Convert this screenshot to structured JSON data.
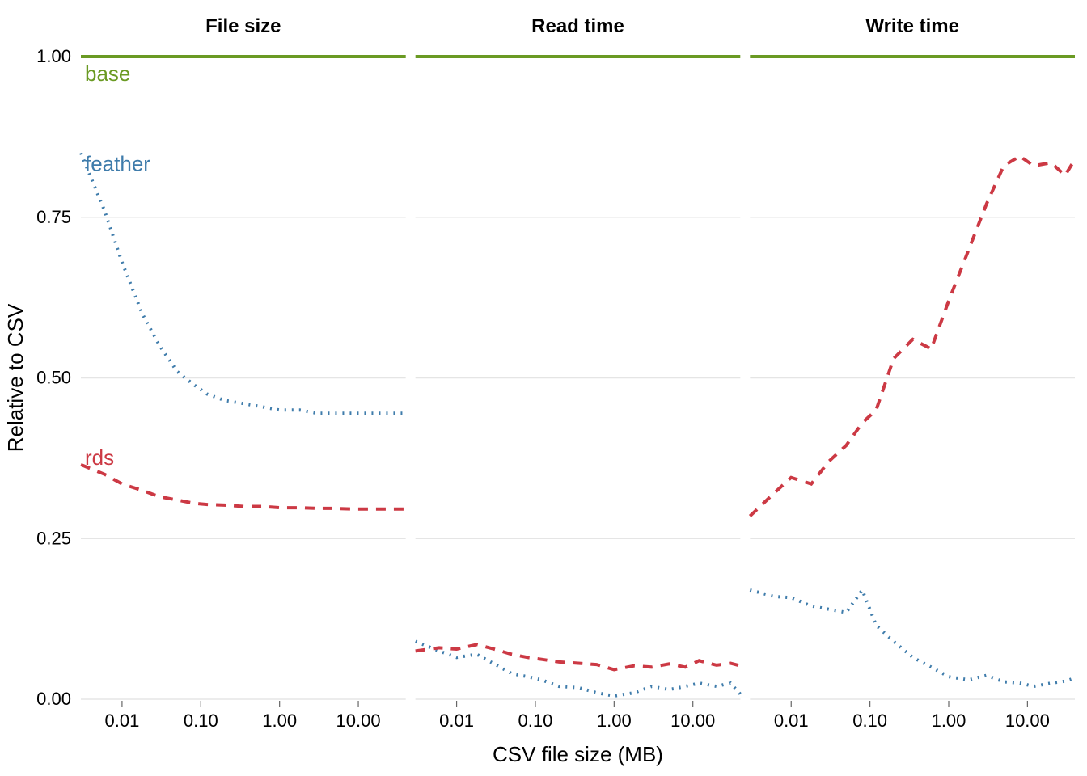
{
  "chart_data": {
    "type": "line",
    "xlabel": "CSV file size (MB)",
    "ylabel": "Relative to CSV",
    "xscale": "log10",
    "ylim": [
      0,
      1
    ],
    "xticks": [
      0.01,
      0.1,
      1.0,
      10.0
    ],
    "xtick_labels": [
      "0.01",
      "0.10",
      "1.00",
      "10.00"
    ],
    "yticks": [
      0.0,
      0.25,
      0.5,
      0.75,
      1.0
    ],
    "ytick_labels": [
      "0.00",
      "0.25",
      "0.50",
      "0.75",
      "1.00"
    ],
    "facets": [
      "File size",
      "Read time",
      "Write time"
    ],
    "colors": {
      "base": "#6a9a23",
      "feather": "#3f7cab",
      "rds": "#cc3944"
    },
    "legend_labels": {
      "base": "base",
      "feather": "feather",
      "rds": "rds"
    },
    "linestyle": {
      "base": "solid",
      "feather": "2,7",
      "rds": "12,10"
    },
    "x": [
      0.003,
      0.006,
      0.01,
      0.018,
      0.03,
      0.05,
      0.08,
      0.12,
      0.2,
      0.35,
      0.6,
      1.0,
      1.8,
      3.0,
      5.0,
      8.0,
      12.0,
      20.0,
      30.0,
      40.0
    ],
    "series": {
      "File size": [
        {
          "name": "base",
          "y": [
            1.0,
            1.0,
            1.0,
            1.0,
            1.0,
            1.0,
            1.0,
            1.0,
            1.0,
            1.0,
            1.0,
            1.0,
            1.0,
            1.0,
            1.0,
            1.0,
            1.0,
            1.0,
            1.0,
            1.0
          ]
        },
        {
          "name": "feather",
          "y": [
            0.85,
            0.76,
            0.68,
            0.6,
            0.55,
            0.51,
            0.49,
            0.475,
            0.465,
            0.46,
            0.455,
            0.45,
            0.45,
            0.445,
            0.445,
            0.445,
            0.445,
            0.445,
            0.445,
            0.445
          ]
        },
        {
          "name": "rds",
          "y": [
            0.365,
            0.35,
            0.335,
            0.325,
            0.315,
            0.31,
            0.305,
            0.303,
            0.302,
            0.3,
            0.3,
            0.298,
            0.298,
            0.297,
            0.297,
            0.296,
            0.296,
            0.296,
            0.296,
            0.296
          ]
        }
      ],
      "Read time": [
        {
          "name": "base",
          "y": [
            1.0,
            1.0,
            1.0,
            1.0,
            1.0,
            1.0,
            1.0,
            1.0,
            1.0,
            1.0,
            1.0,
            1.0,
            1.0,
            1.0,
            1.0,
            1.0,
            1.0,
            1.0,
            1.0,
            1.0
          ]
        },
        {
          "name": "feather",
          "y": [
            0.09,
            0.075,
            0.065,
            0.07,
            0.055,
            0.04,
            0.035,
            0.03,
            0.02,
            0.018,
            0.01,
            0.005,
            0.01,
            0.02,
            0.015,
            0.02,
            0.025,
            0.02,
            0.025,
            0.008
          ]
        },
        {
          "name": "rds",
          "y": [
            0.075,
            0.08,
            0.078,
            0.085,
            0.078,
            0.07,
            0.065,
            0.062,
            0.058,
            0.056,
            0.054,
            0.046,
            0.052,
            0.05,
            0.055,
            0.05,
            0.06,
            0.053,
            0.056,
            0.052
          ]
        }
      ],
      "Write time": [
        {
          "name": "base",
          "y": [
            1.0,
            1.0,
            1.0,
            1.0,
            1.0,
            1.0,
            1.0,
            1.0,
            1.0,
            1.0,
            1.0,
            1.0,
            1.0,
            1.0,
            1.0,
            1.0,
            1.0,
            1.0,
            1.0,
            1.0
          ]
        },
        {
          "name": "feather",
          "y": [
            0.17,
            0.16,
            0.158,
            0.145,
            0.14,
            0.135,
            0.17,
            0.115,
            0.09,
            0.065,
            0.05,
            0.035,
            0.03,
            0.037,
            0.027,
            0.025,
            0.02,
            0.025,
            0.028,
            0.033
          ]
        },
        {
          "name": "rds",
          "y": [
            0.285,
            0.32,
            0.345,
            0.335,
            0.37,
            0.395,
            0.43,
            0.45,
            0.53,
            0.56,
            0.545,
            0.62,
            0.7,
            0.77,
            0.83,
            0.845,
            0.83,
            0.835,
            0.815,
            0.84,
            0.823,
            0.83,
            0.818
          ]
        }
      ]
    }
  }
}
